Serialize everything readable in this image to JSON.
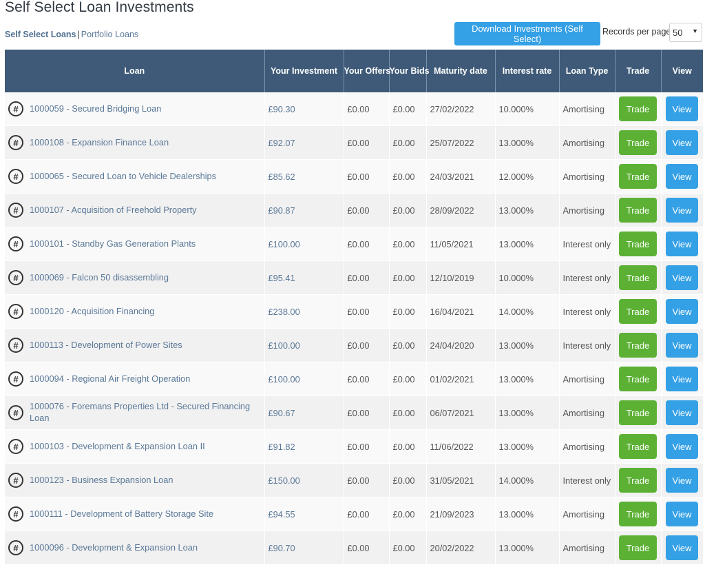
{
  "page": {
    "title": "Self Select Loan Investments"
  },
  "subnav": {
    "items": [
      {
        "label": "Self Select Loans",
        "active": true
      },
      {
        "label": "Portfolio Loans",
        "active": false
      }
    ],
    "separator": "|"
  },
  "toolbar": {
    "download_label": "Download Investments (Self Select)",
    "records_per_page_label": "Records per page",
    "records_per_page_value": "50",
    "caret": "▼"
  },
  "table": {
    "columns": [
      "Loan",
      "Your Investment",
      "Your Offers",
      "Your Bids",
      "Maturity date",
      "Interest rate",
      "Loan Type",
      "Trade",
      "View"
    ],
    "trade_label": "Trade",
    "view_label": "View",
    "hash_icon": "#",
    "rows": [
      {
        "loan": "1000059 - Secured Bridging Loan",
        "investment": "£90.30",
        "offers": "£0.00",
        "bids": "£0.00",
        "maturity": "27/02/2022",
        "rate": "10.000%",
        "type": "Amortising"
      },
      {
        "loan": "1000108 - Expansion Finance Loan",
        "investment": "£92.07",
        "offers": "£0.00",
        "bids": "£0.00",
        "maturity": "25/07/2022",
        "rate": "13.000%",
        "type": "Amortising"
      },
      {
        "loan": "1000065 - Secured Loan to Vehicle Dealerships",
        "investment": "£85.62",
        "offers": "£0.00",
        "bids": "£0.00",
        "maturity": "24/03/2021",
        "rate": "12.000%",
        "type": "Amortising"
      },
      {
        "loan": "1000107 - Acquisition of Freehold Property",
        "investment": "£90.87",
        "offers": "£0.00",
        "bids": "£0.00",
        "maturity": "28/09/2022",
        "rate": "13.000%",
        "type": "Amortising"
      },
      {
        "loan": "1000101 - Standby Gas Generation Plants",
        "investment": "£100.00",
        "offers": "£0.00",
        "bids": "£0.00",
        "maturity": "11/05/2021",
        "rate": "13.000%",
        "type": "Interest only"
      },
      {
        "loan": "1000069 - Falcon 50 disassembling",
        "investment": "£95.41",
        "offers": "£0.00",
        "bids": "£0.00",
        "maturity": "12/10/2019",
        "rate": "10.000%",
        "type": "Interest only"
      },
      {
        "loan": "1000120 - Acquisition Financing",
        "investment": "£238.00",
        "offers": "£0.00",
        "bids": "£0.00",
        "maturity": "16/04/2021",
        "rate": "14.000%",
        "type": "Interest only"
      },
      {
        "loan": "1000113 - Development of Power Sites",
        "investment": "£100.00",
        "offers": "£0.00",
        "bids": "£0.00",
        "maturity": "24/04/2020",
        "rate": "13.000%",
        "type": "Interest only"
      },
      {
        "loan": "1000094 - Regional Air Freight Operation",
        "investment": "£100.00",
        "offers": "£0.00",
        "bids": "£0.00",
        "maturity": "01/02/2021",
        "rate": "13.000%",
        "type": "Amortising"
      },
      {
        "loan": "1000076 - Foremans Properties Ltd - Secured Financing Loan",
        "investment": "£90.67",
        "offers": "£0.00",
        "bids": "£0.00",
        "maturity": "06/07/2021",
        "rate": "13.000%",
        "type": "Amortising"
      },
      {
        "loan": "1000103 - Development & Expansion Loan II",
        "investment": "£91.82",
        "offers": "£0.00",
        "bids": "£0.00",
        "maturity": "11/06/2022",
        "rate": "13.000%",
        "type": "Amortising"
      },
      {
        "loan": "1000123 - Business Expansion Loan",
        "investment": "£150.00",
        "offers": "£0.00",
        "bids": "£0.00",
        "maturity": "31/05/2021",
        "rate": "14.000%",
        "type": "Interest only"
      },
      {
        "loan": "1000111 - Development of Battery Storage Site",
        "investment": "£94.55",
        "offers": "£0.00",
        "bids": "£0.00",
        "maturity": "21/09/2023",
        "rate": "13.000%",
        "type": "Amortising"
      },
      {
        "loan": "1000096 - Development & Expansion Loan",
        "investment": "£90.70",
        "offers": "£0.00",
        "bids": "£0.00",
        "maturity": "20/02/2022",
        "rate": "13.000%",
        "type": "Amortising"
      }
    ]
  },
  "colors": {
    "header_bg": "#3e5a78",
    "link": "#5a7898",
    "trade_green": "#5cb135",
    "view_blue": "#34a0e6"
  }
}
